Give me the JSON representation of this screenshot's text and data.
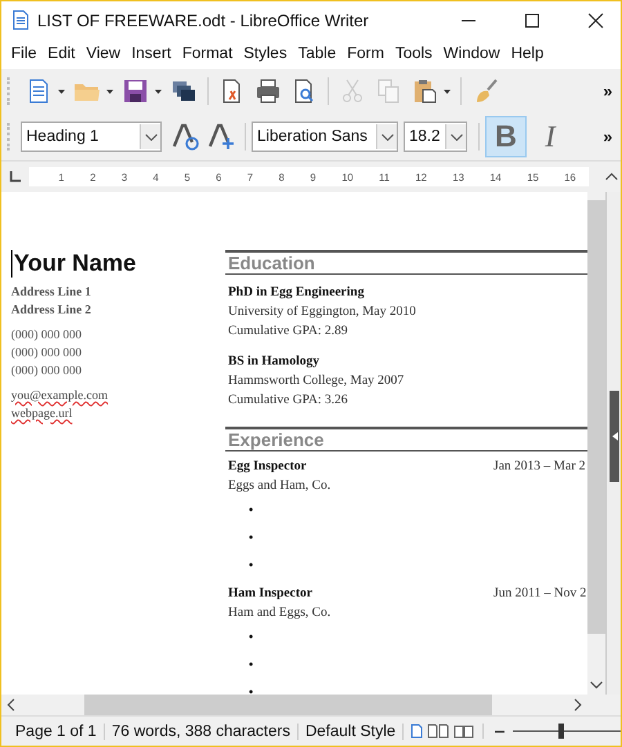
{
  "window": {
    "title": "LIST OF FREEWARE.odt - LibreOffice Writer"
  },
  "menu": [
    "File",
    "Edit",
    "View",
    "Insert",
    "Format",
    "Styles",
    "Table",
    "Form",
    "Tools",
    "Window",
    "Help"
  ],
  "standard_toolbar": [
    {
      "kind": "new",
      "dropdown": true,
      "disabled": false
    },
    {
      "kind": "open",
      "dropdown": true,
      "disabled": false
    },
    {
      "kind": "save",
      "dropdown": true,
      "disabled": false
    },
    {
      "kind": "templates",
      "dropdown": false,
      "disabled": false
    },
    {
      "kind": "sep"
    },
    {
      "kind": "pdf",
      "dropdown": false,
      "disabled": false
    },
    {
      "kind": "print",
      "dropdown": false,
      "disabled": false
    },
    {
      "kind": "preview",
      "dropdown": false,
      "disabled": false
    },
    {
      "kind": "sep"
    },
    {
      "kind": "cut",
      "dropdown": false,
      "disabled": true
    },
    {
      "kind": "copy",
      "dropdown": false,
      "disabled": true
    },
    {
      "kind": "paste",
      "dropdown": true,
      "disabled": false
    },
    {
      "kind": "sep"
    },
    {
      "kind": "brush",
      "dropdown": false,
      "disabled": false
    }
  ],
  "overflow_chevron": "»",
  "formatting_toolbar": {
    "paragraph_style": "Heading 1",
    "font_name": "Liberation Sans",
    "font_size": "18.2",
    "format_buttons": [
      {
        "label": "B",
        "selected": true
      },
      {
        "label": "I",
        "selected": false
      }
    ],
    "overflow_chevron": "»"
  },
  "ruler": [
    "1",
    "2",
    "3",
    "4",
    "5",
    "6",
    "7",
    "8",
    "9",
    "10",
    "11",
    "12",
    "13",
    "14",
    "15",
    "16"
  ],
  "document": {
    "name": "Your Name",
    "contact_groups": [
      [
        {
          "text": "Address Line 1",
          "misspelled": false
        },
        {
          "text": "Address Line 2",
          "misspelled": false
        }
      ],
      [
        {
          "text": "(000) 000 000",
          "misspelled": false
        },
        {
          "text": "(000) 000 000",
          "misspelled": false
        },
        {
          "text": "(000) 000 000",
          "misspelled": false
        }
      ],
      [
        {
          "text": "you@example.com",
          "misspelled": true
        },
        {
          "text": "webpage.url",
          "misspelled": true
        }
      ]
    ],
    "education": {
      "heading": "Education",
      "entries": [
        {
          "degree": "PhD in Egg Engineering",
          "school": "University of Eggington, May 2010",
          "gpa": "Cumulative GPA: 2.89"
        },
        {
          "degree": "BS in Hamology",
          "school": "Hammsworth College, May 2007",
          "gpa": "Cumulative GPA: 3.26"
        }
      ]
    },
    "experience": {
      "heading": "Experience",
      "jobs": [
        {
          "title": "Egg Inspector",
          "dates": "Jan 2013 – Mar 2",
          "company": "Eggs and Ham, Co.",
          "bullets": [
            "•",
            "•",
            "•"
          ]
        },
        {
          "title": "Ham Inspector",
          "dates": "Jun 2011 – Nov 2",
          "company": "Ham and Eggs, Co.",
          "bullets": [
            "•",
            "•",
            "•"
          ]
        }
      ]
    }
  },
  "status_bar": {
    "page": "Page 1 of 1",
    "count": "76 words, 388 characters",
    "page_style": "Default Style",
    "zoom": {
      "level": 0.45
    }
  }
}
